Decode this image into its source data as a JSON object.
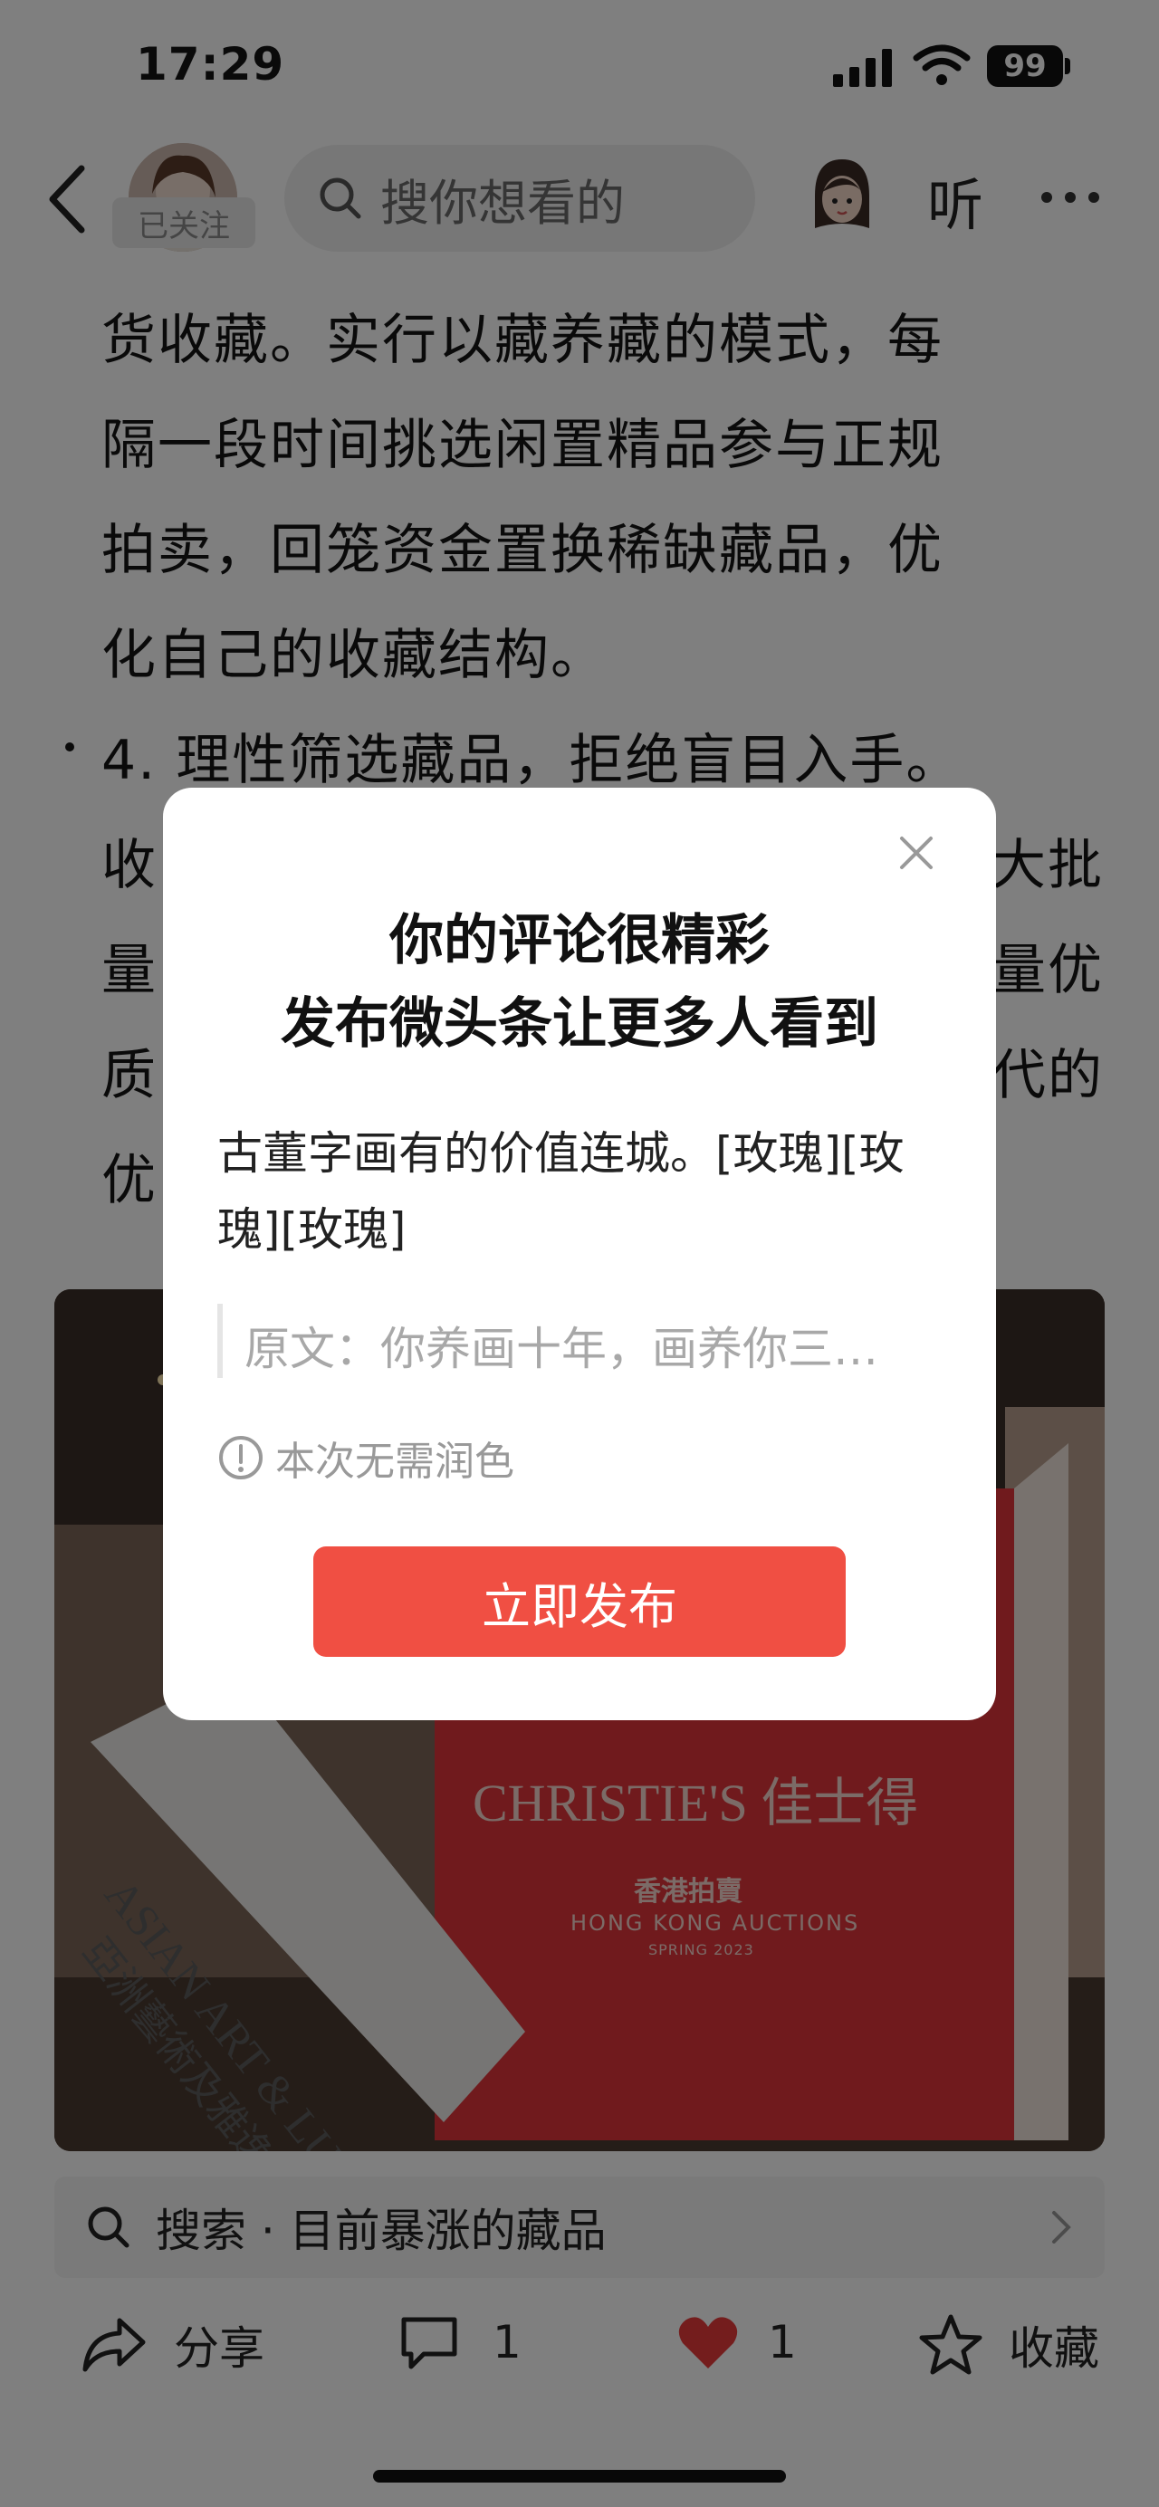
{
  "status_bar": {
    "time": "17:29",
    "battery": "99"
  },
  "nav": {
    "followed_label": "已关注",
    "search_placeholder": "搜你想看的",
    "listen_label": "听"
  },
  "article": {
    "paragraphs": [
      "货收藏。实行以藏养藏的模式，每",
      "隔一段时间挑选闲置精品参与正规",
      "拍卖，回笼资金置换稀缺藏品，优",
      "化自己的收藏结构。",
      "4. 理性筛选藏品，拒绝盲目入手。",
      "收",
      "大批",
      "量",
      "量优",
      "质",
      "代的",
      "优"
    ]
  },
  "photo": {
    "sign_left_line1": "ASIAN ART & LUXURY",
    "sign_left_line2": "亞洲藝術及雅逸精品",
    "brand": "CHRISTIE'S 佳士得",
    "subtitle_cn": "香港拍賣",
    "subtitle_en": "HONG KONG AUCTIONS",
    "season": "SPRING 2023"
  },
  "related_search": {
    "label": "搜索 · 目前暴涨的藏品"
  },
  "actions": {
    "share": "分享",
    "comment_count": "1",
    "like_count": "1",
    "favorite": "收藏"
  },
  "dialog": {
    "title_line1": "你的评论很精彩",
    "title_line2": "发布微头条让更多人看到",
    "comment_text": "古董字画有的价值连城。[玫瑰][玫瑰][玫瑰]",
    "quote_text": "原文：你养画十年，画养你三…",
    "hint_text": "本次无需润色",
    "publish_label": "立即发布"
  },
  "colors": {
    "accent_red": "#f04f43",
    "like_red": "#e83b3b"
  }
}
